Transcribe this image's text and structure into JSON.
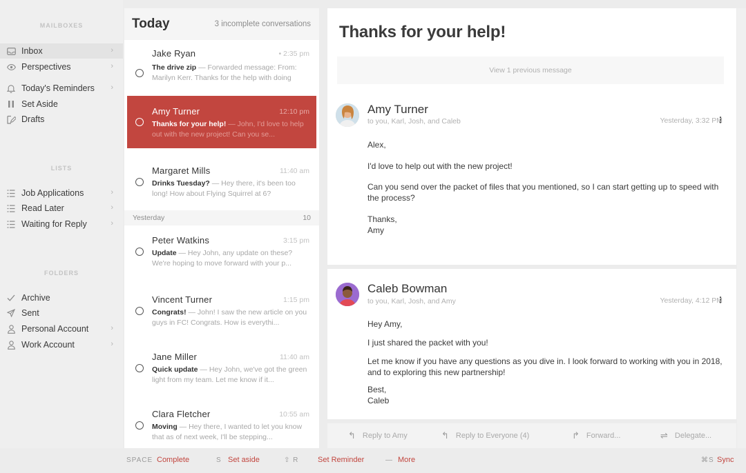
{
  "sidebar": {
    "sections": [
      {
        "title": "MAILBOXES"
      },
      {
        "title": "LISTS"
      },
      {
        "title": "FOLDERS"
      }
    ],
    "items": [
      {
        "label": "Inbox",
        "icon": "inbox-icon"
      },
      {
        "label": "Perspectives",
        "icon": "eye-icon"
      },
      {
        "label": "Today's Reminders",
        "icon": "bell-icon"
      },
      {
        "label": "Set Aside",
        "icon": "pause-icon"
      },
      {
        "label": "Drafts",
        "icon": "draft-pencil-icon"
      },
      {
        "label": "Job Applications",
        "icon": "list-icon"
      },
      {
        "label": "Read Later",
        "icon": "list-icon"
      },
      {
        "label": "Waiting for Reply",
        "icon": "list-icon"
      },
      {
        "label": "Archive",
        "icon": "check-icon"
      },
      {
        "label": "Sent",
        "icon": "paper-plane-icon"
      },
      {
        "label": "Personal Account",
        "icon": "person-icon"
      },
      {
        "label": "Work Account",
        "icon": "person-icon"
      }
    ]
  },
  "list": {
    "title": "Today",
    "meta": "3 incomplete conversations",
    "day_separator": {
      "label": "Yesterday",
      "count": "10"
    },
    "conversations": [
      {
        "name": "Jake Ryan",
        "time": "• 2:35 pm",
        "subject": "The drive zip",
        "preview": " — Forwarded message: From: Marilyn Kerr. Thanks for the help with doing"
      },
      {
        "name": "Amy Turner",
        "time": "12:10 pm",
        "subject": "Thanks for your help!",
        "preview": " — John, I'd love to help out with the new project! Can you se..."
      },
      {
        "name": "Margaret Mills",
        "time": "11:40 am",
        "subject": "Drinks Tuesday?",
        "preview": " — Hey there, it's been too long! How about Flying Squirrel at 6?"
      },
      {
        "name": "Peter Watkins",
        "time": "3:15 pm",
        "subject": "Update",
        "preview": " — Hey John, any update on these? We're hoping to move forward with your p..."
      },
      {
        "name": "Vincent Turner",
        "time": "1:15 pm",
        "subject": "Congrats!",
        "preview": " — John! I saw the new article on you guys in FC! Congrats. How is everythi..."
      },
      {
        "name": "Jane Miller",
        "time": "11:40 am",
        "subject": "Quick update",
        "preview": " — Hey John, we've got the green light from my team. Let me know if it..."
      },
      {
        "name": "Clara Fletcher",
        "time": "10:55 am",
        "subject": "Moving",
        "preview": " — Hey there, I wanted to let you know that as of next week, I'll be stepping..."
      }
    ]
  },
  "reader": {
    "subject": "Thanks for your help!",
    "previous": "View 1 previous message",
    "messages": [
      {
        "sender": "Amy Turner",
        "recipients": "to you, Karl, Josh, and Caleb",
        "timestamp": "Yesterday, 3:32 PM",
        "body": [
          "Alex,",
          "I'd love to help out with the new project!",
          "Can you send over the packet of files that you mentioned, so I can start getting up to speed with the process?",
          "Thanks,\nAmy"
        ]
      },
      {
        "sender": "Caleb Bowman",
        "recipients": "to you, Karl, Josh, and Amy",
        "timestamp": "Yesterday, 4:12 PM",
        "body": [
          "Hey Amy,",
          "I just shared the packet with you!",
          "Let me know if you have any questions as you dive in. I look forward to working with you in 2018, and to exploring this new partnership!",
          "Best,\nCaleb"
        ]
      }
    ],
    "actions": [
      {
        "label": "Reply to Amy",
        "icon": "reply-icon"
      },
      {
        "label": "Reply to Everyone (4)",
        "icon": "reply-all-icon"
      },
      {
        "label": "Forward...",
        "icon": "forward-icon"
      },
      {
        "label": "Delegate...",
        "icon": "delegate-icon"
      }
    ]
  },
  "bottombar": {
    "shortcuts": [
      {
        "key": "SPACE",
        "label": "Complete"
      },
      {
        "key": "S",
        "label": "Set aside"
      },
      {
        "key": "⇧ R",
        "label": "Set Reminder"
      },
      {
        "key": "—",
        "label": "More"
      }
    ],
    "sync_key": "⌘S",
    "sync_label": "Sync"
  },
  "colors": {
    "accent": "#c2463f",
    "background": "#ececec"
  }
}
